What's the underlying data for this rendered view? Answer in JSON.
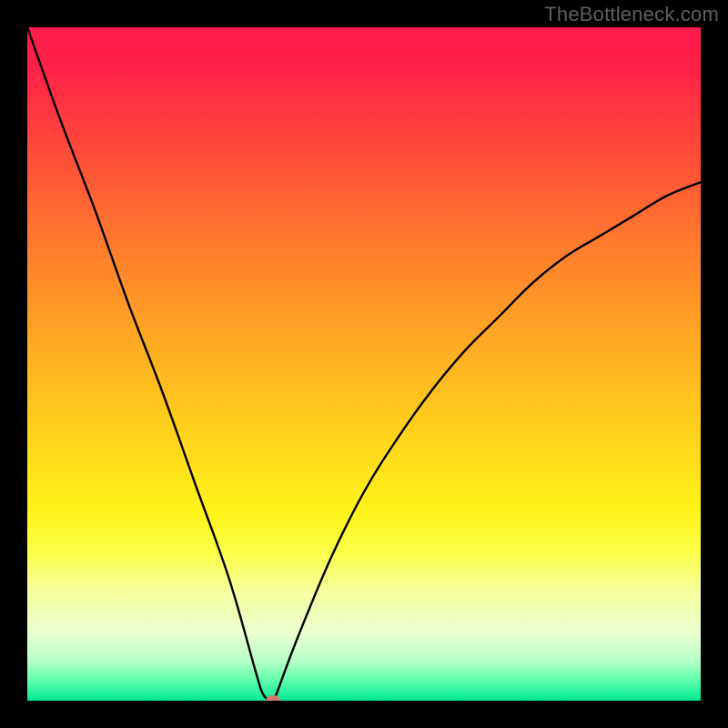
{
  "watermark": "TheBottleneck.com",
  "chart_data": {
    "type": "line",
    "title": "",
    "xlabel": "",
    "ylabel": "",
    "xlim": [
      0,
      100
    ],
    "ylim": [
      0,
      100
    ],
    "background_gradient": {
      "stops": [
        {
          "offset": 0.0,
          "color": "#ff1a4b"
        },
        {
          "offset": 0.06,
          "color": "#ff2148"
        },
        {
          "offset": 0.18,
          "color": "#ff4a3a"
        },
        {
          "offset": 0.32,
          "color": "#ff7a2d"
        },
        {
          "offset": 0.46,
          "color": "#ffa723"
        },
        {
          "offset": 0.6,
          "color": "#ffd21c"
        },
        {
          "offset": 0.72,
          "color": "#fff31a"
        },
        {
          "offset": 0.78,
          "color": "#fbff4a"
        },
        {
          "offset": 0.84,
          "color": "#f6ffa0"
        },
        {
          "offset": 0.9,
          "color": "#eaffd0"
        },
        {
          "offset": 0.94,
          "color": "#b8ffc8"
        },
        {
          "offset": 0.97,
          "color": "#5fffad"
        },
        {
          "offset": 1.0,
          "color": "#00e893"
        }
      ]
    },
    "series": [
      {
        "name": "bottleneck-curve",
        "color": "#000000",
        "x": [
          0,
          5,
          10,
          15,
          20,
          25,
          30,
          34,
          35,
          36,
          36.5,
          37,
          40,
          45,
          50,
          55,
          60,
          65,
          70,
          75,
          80,
          85,
          90,
          95,
          100
        ],
        "values": [
          100,
          86,
          73,
          59,
          46,
          32,
          18,
          4,
          1,
          0,
          0,
          1,
          9,
          21,
          31,
          39,
          46,
          52,
          57,
          62,
          66,
          69,
          72,
          75,
          77
        ]
      }
    ],
    "marker": {
      "name": "optimal-point",
      "x": 36.5,
      "y": 0,
      "color": "#cf7b70",
      "rx": 8,
      "ry": 6
    }
  }
}
